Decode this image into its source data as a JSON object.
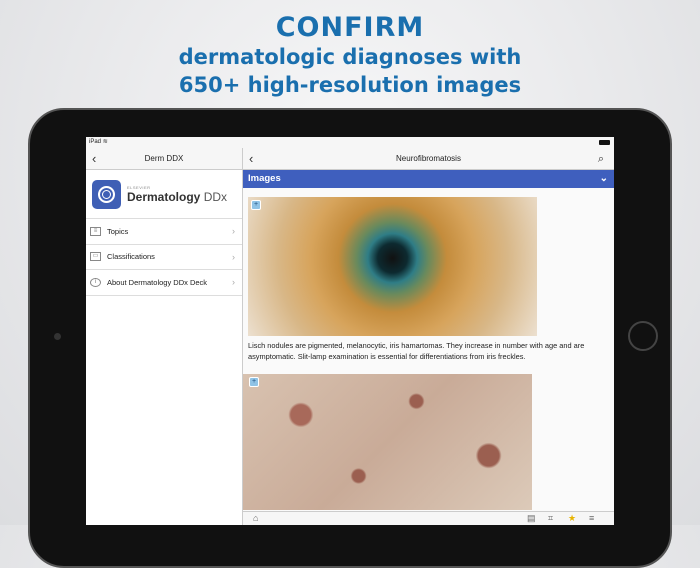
{
  "headline": {
    "title": "CONFIRM",
    "line1": "dermatologic diagnoses with",
    "line2": "650+ high-resolution images"
  },
  "status": {
    "device": "iPad"
  },
  "left_panel": {
    "nav_title": "Derm DDX",
    "brand_publisher": "ELSEVIER",
    "brand_name": "Dermatology",
    "brand_suffix": "DDx",
    "items": [
      {
        "label": "Topics"
      },
      {
        "label": "Classifications"
      },
      {
        "label": "About Dermatology DDx Deck"
      }
    ]
  },
  "right_panel": {
    "nav_title": "Neurofibromatosis",
    "section": "Images",
    "caption": "Lisch nodules are pigmented, melanocytic, iris hamartomas. They increase in number with age and are asymptomatic. Slit-lamp examination is essential for differentiations from iris freckles."
  },
  "colors": {
    "accent": "#3f5fbe",
    "headline": "#1a6fae"
  }
}
